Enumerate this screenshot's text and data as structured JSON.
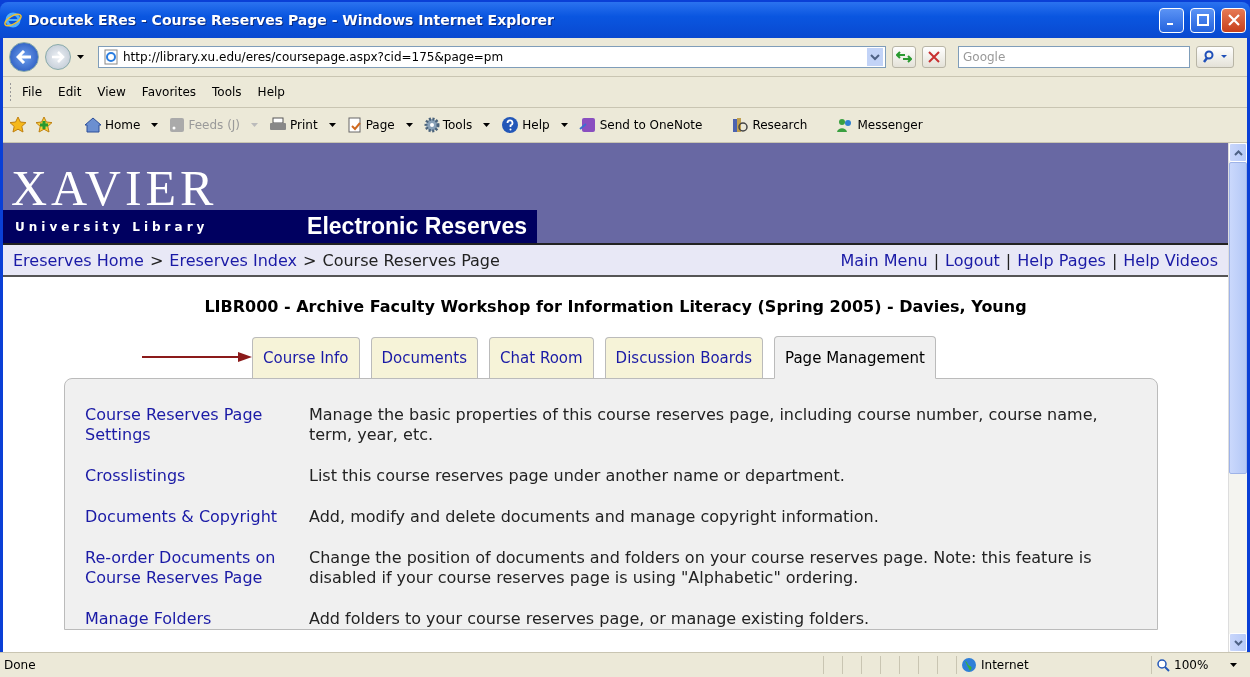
{
  "window": {
    "title": "Docutek ERes - Course Reserves Page - Windows Internet Explorer"
  },
  "address_bar": {
    "url": "http://library.xu.edu/eres/coursepage.aspx?cid=175&page=pm"
  },
  "search": {
    "placeholder": "Google"
  },
  "menu": [
    "File",
    "Edit",
    "View",
    "Favorites",
    "Tools",
    "Help"
  ],
  "toolbar": [
    {
      "label": "Home",
      "kind": "home",
      "disabled": false,
      "dropdown": true
    },
    {
      "label": "Feeds (J)",
      "kind": "feed",
      "disabled": true,
      "dropdown": true
    },
    {
      "label": "Print",
      "kind": "print",
      "disabled": false,
      "dropdown": true
    },
    {
      "label": "Page",
      "kind": "page",
      "disabled": false,
      "dropdown": true
    },
    {
      "label": "Tools",
      "kind": "gear",
      "disabled": false,
      "dropdown": true
    },
    {
      "label": "Help",
      "kind": "help",
      "disabled": false,
      "dropdown": true
    },
    {
      "label": "Send to OneNote",
      "kind": "note",
      "disabled": false,
      "dropdown": false
    },
    {
      "label": "Research",
      "kind": "book",
      "disabled": false,
      "dropdown": false
    },
    {
      "label": "Messenger",
      "kind": "people",
      "disabled": false,
      "dropdown": false
    }
  ],
  "header": {
    "logo": "XAVIER",
    "subtitle": "University Library",
    "section": "Electronic Reserves"
  },
  "breadcrumb": {
    "separator": ">",
    "items": [
      {
        "label": "Ereserves Home",
        "link": true
      },
      {
        "label": "Ereserves Index",
        "link": true
      },
      {
        "label": "Course Reserves Page",
        "link": false
      }
    ]
  },
  "nav_links": {
    "separator": "|",
    "items": [
      "Main Menu",
      "Logout",
      "Help Pages",
      "Help Videos"
    ]
  },
  "course_title": "LIBR000 - Archive Faculty Workshop for Information Literacy (Spring 2005) - Davies, Young",
  "tabs": [
    {
      "label": "Course Info",
      "selected": false,
      "pointed": true
    },
    {
      "label": "Documents",
      "selected": false,
      "pointed": false
    },
    {
      "label": "Chat Room",
      "selected": false,
      "pointed": false
    },
    {
      "label": "Discussion Boards",
      "selected": false,
      "pointed": false
    },
    {
      "label": "Page Management",
      "selected": true,
      "pointed": false
    }
  ],
  "rows": [
    {
      "link": "Course Reserves Page Settings",
      "description": "Manage the basic properties of this course reserves page, including course number, course name, term, year, etc."
    },
    {
      "link": "Crosslistings",
      "description": "List this course reserves page under another name or department."
    },
    {
      "link": "Documents & Copyright",
      "description": "Add, modify and delete documents and manage copyright information."
    },
    {
      "link": "Re-order Documents on Course Reserves Page",
      "description": "Change the position of documents and folders on your course reserves page. Note: this feature is disabled if your course reserves page is using \"Alphabetic\" ordering."
    },
    {
      "link": "Manage Folders",
      "description": "Add folders to your course reserves page, or manage existing folders."
    }
  ],
  "status_bar": {
    "text": "Done",
    "zone": "Internet",
    "zoom": "100%"
  }
}
